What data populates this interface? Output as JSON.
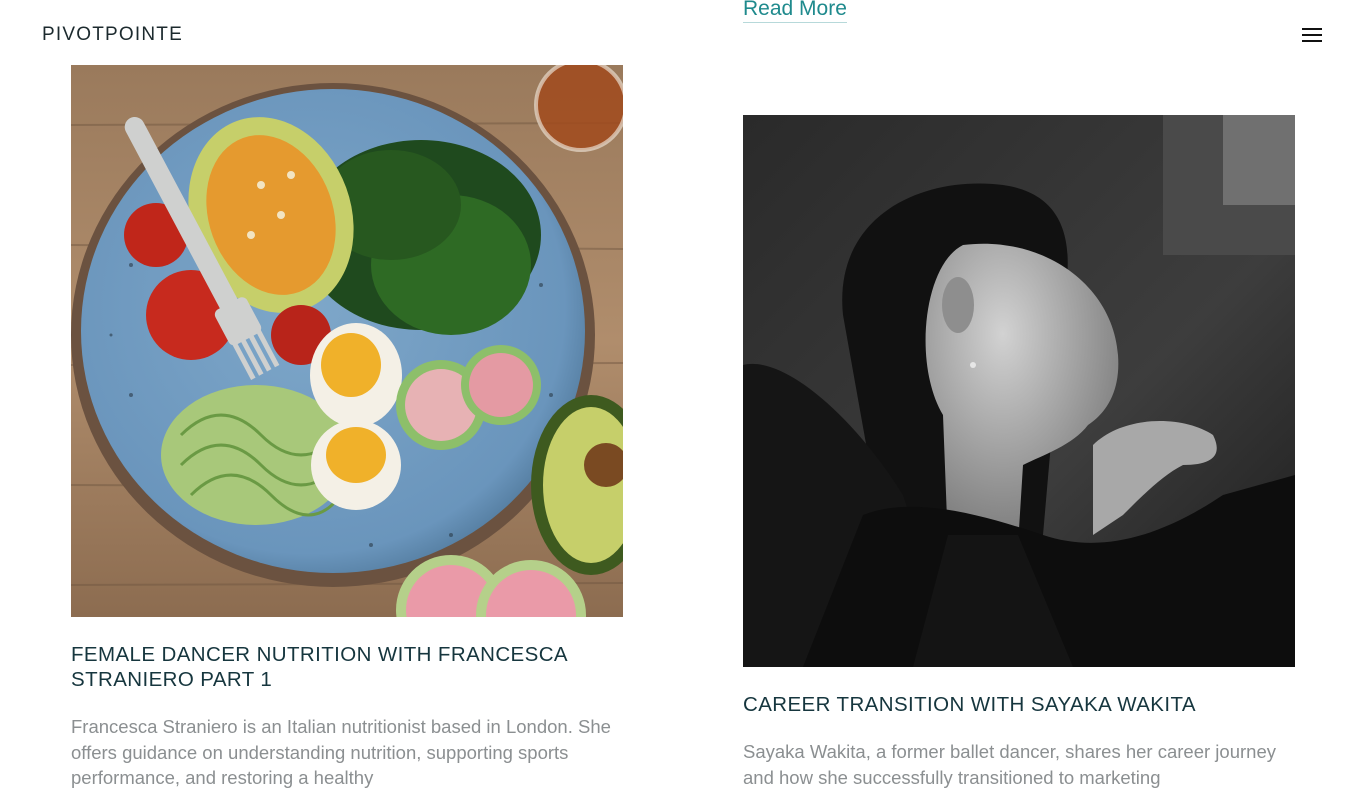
{
  "header": {
    "logo": "PIVOTPOINTE",
    "menu_icon": "hamburger-menu-icon"
  },
  "previous_post": {
    "read_more_label": "Read More"
  },
  "posts": [
    {
      "image_alt": "Bowl of salad with avocado, boiled eggs, tomatoes, spinach, radish slices and zucchini noodles",
      "title": "FEMALE DANCER NUTRITION WITH FRANCESCA STRANIERO PART 1",
      "excerpt": "Francesca Straniero is an Italian nutritionist based in London. She offers guidance on understanding nutrition, supporting sports performance, and restoring a healthy"
    },
    {
      "image_alt": "Black and white portrait of a dancer",
      "title": "CAREER TRANSITION WITH SAYAKA WAKITA",
      "excerpt": "Sayaka Wakita, a former ballet dancer, shares her career journey and how she successfully transitioned to marketing"
    }
  ],
  "colors": {
    "link": "#1f8a8d",
    "title": "#16363e",
    "body_text": "#8b8f91"
  }
}
